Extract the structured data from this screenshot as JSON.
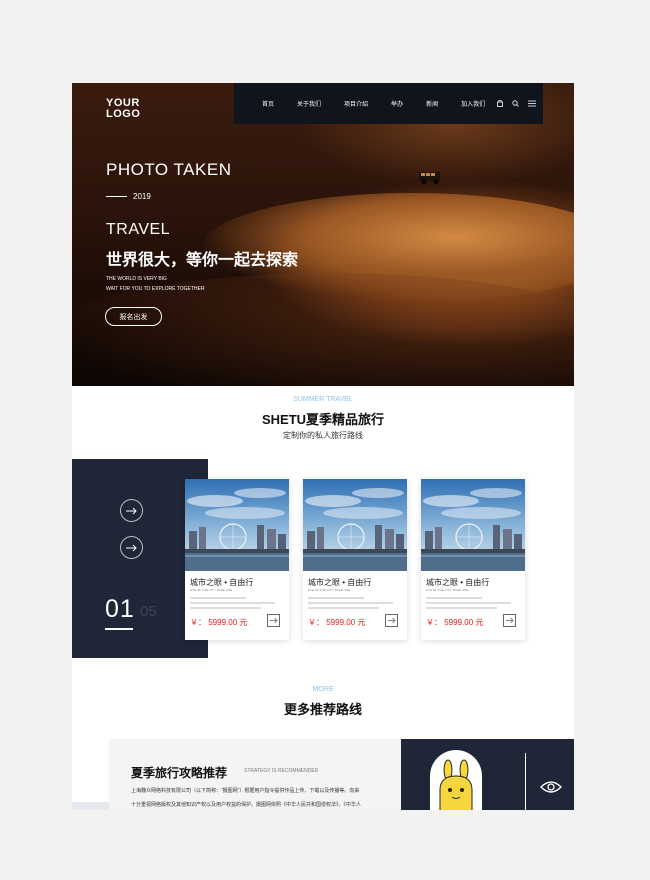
{
  "logo": {
    "line1": "YOUR",
    "line2": "LOGO"
  },
  "nav": {
    "items": [
      "首页",
      "关于我们",
      "项目介绍",
      "举办",
      "新闻",
      "加入我们"
    ],
    "icons": [
      "bag-icon",
      "search-icon",
      "menu-icon"
    ]
  },
  "hero": {
    "photo_taken": "PHOTO TAKEN",
    "year": "2019",
    "travel": "TRAVEL",
    "headline": "世界很大，等你一起去探索",
    "sub_line1": "THE WORLD IS VERY BIG",
    "sub_line2": "WAIT FOR YOU TO EXPLORE TOGETHER",
    "button": "报名出发"
  },
  "summer": {
    "kicker": "SUMMER TRAVEL",
    "title": "SHETU夏季精品旅行",
    "subtitle": "定制你的私人旅行路线",
    "current_page": "01",
    "next_page": "05"
  },
  "cards": [
    {
      "title": "城市之眼 • 自由行",
      "subtitle": "EYE OF THE CITY, FREE LINE",
      "price": "￥：  5999.00 元"
    },
    {
      "title": "城市之眼 • 自由行",
      "subtitle": "EYE OF THE CITY, FREE LINE",
      "price": "￥：  5999.00 元"
    },
    {
      "title": "城市之眼 • 自由行",
      "subtitle": "EYE OF THE CITY, FREE LINE",
      "price": "￥：  5999.00 元"
    }
  ],
  "more": {
    "kicker": "MORE",
    "title": "更多推荐路线"
  },
  "strategy": {
    "title": "夏季旅行攻略推荐",
    "en": "STRATEGY IS RECOMMENDED",
    "line1": "上海魏众网络科技有限公司（以下简称：“摄图网”）根据用户指令提供作品上传、下载以及传播等。向来",
    "line2": "十分重视网络版权及其他知识产权以及用户权益的保护。摄图网依照《中华人民共和国侵权法》、《中华人"
  },
  "colors": {
    "dark": "#1f2637",
    "nav": "#0f141d",
    "accent_blue": "#8ec3e8",
    "price_red": "#e0201b"
  }
}
